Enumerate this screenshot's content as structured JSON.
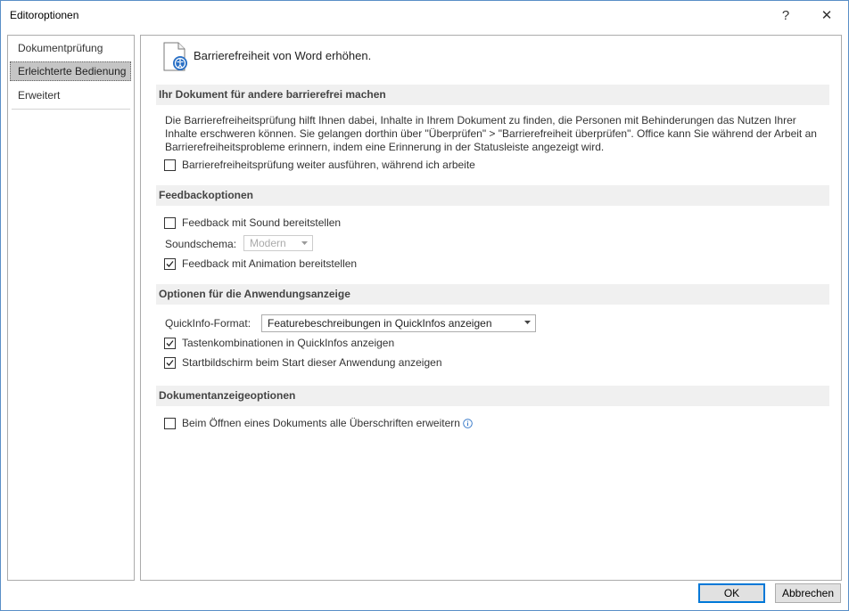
{
  "window": {
    "title": "Editoroptionen",
    "help_glyph": "?",
    "close_glyph": "✕"
  },
  "sidebar": {
    "items": [
      {
        "label": "Dokumentprüfung",
        "selected": false
      },
      {
        "label": "Erleichterte Bedienung",
        "selected": true
      },
      {
        "label": "Erweitert",
        "selected": false
      }
    ]
  },
  "header": {
    "icon": "accessibility-document-icon",
    "text": "Barrierefreiheit von Word erhöhen."
  },
  "sections": {
    "accessibility": {
      "title": "Ihr Dokument für andere barrierefrei machen",
      "description": "Die Barrierefreiheitsprüfung hilft Ihnen dabei, Inhalte in Ihrem Dokument zu finden, die Personen mit Behinderungen das Nutzen Ihrer Inhalte erschweren können. Sie gelangen dorthin über \"Überprüfen\" > \"Barrierefreiheit überprüfen\". Office kann Sie während der Arbeit an Barrierefreiheitsprobleme erinnern, indem eine Erinnerung in der Statusleiste angezeigt wird.",
      "keep_running": {
        "label": "Barrierefreiheitsprüfung weiter ausführen, während ich arbeite",
        "checked": false
      }
    },
    "feedback": {
      "title": "Feedbackoptionen",
      "sound": {
        "label": "Feedback mit Sound bereitstellen",
        "checked": false
      },
      "sound_scheme": {
        "label": "Soundschema:",
        "value": "Modern",
        "enabled": false
      },
      "animation": {
        "label": "Feedback mit Animation bereitstellen",
        "checked": true
      }
    },
    "display": {
      "title": "Optionen für die Anwendungsanzeige",
      "quickinfo": {
        "label": "QuickInfo-Format:",
        "value": "Featurebeschreibungen in QuickInfos anzeigen"
      },
      "shortcuts": {
        "label": "Tastenkombinationen in QuickInfos anzeigen",
        "checked": true
      },
      "startscreen": {
        "label": "Startbildschirm beim Start dieser Anwendung anzeigen",
        "checked": true
      }
    },
    "document_view": {
      "title": "Dokumentanzeigeoptionen",
      "expand_headings": {
        "label": "Beim Öffnen eines Dokuments alle Überschriften erweitern",
        "checked": false,
        "icon": "info-icon"
      }
    }
  },
  "buttons": {
    "ok": "OK",
    "cancel": "Abbrechen"
  },
  "colors": {
    "accent": "#0078d7",
    "section_bg": "#f0f0f0",
    "selected_nav": "#c5c5c5",
    "window_border": "#5a8fc7"
  }
}
